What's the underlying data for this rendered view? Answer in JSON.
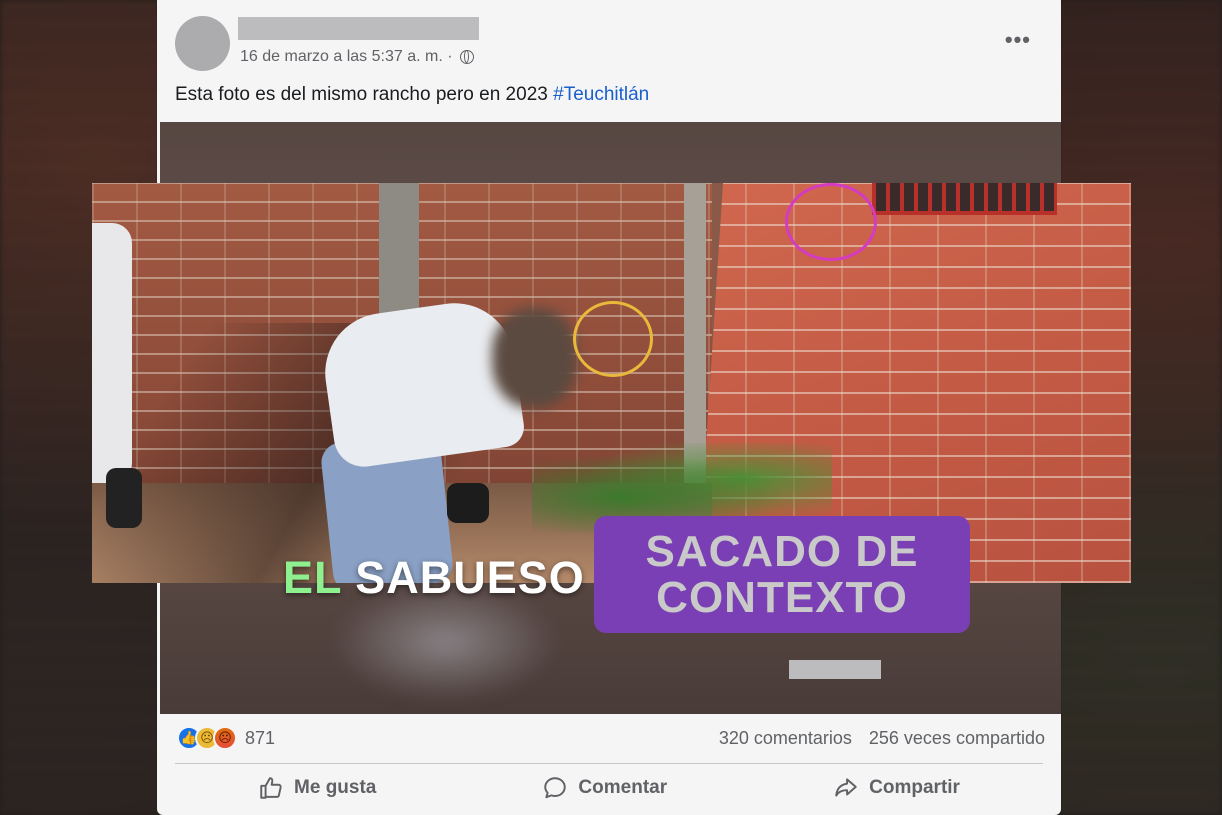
{
  "post": {
    "date": "16 de marzo a las 5:37 a. m. ·",
    "more_label": "•••",
    "text": "Esta foto es del mismo rancho pero en 2023",
    "hashtag": "#Teuchitlán",
    "reaction_count": "871",
    "comments": "320 comentarios",
    "shares": "256 veces compartido",
    "reactions": [
      "like-icon",
      "sad-icon",
      "angry-icon"
    ]
  },
  "actions": {
    "like": "Me gusta",
    "comment": "Comentar",
    "share": "Compartir"
  },
  "overlay": {
    "brand_el": "EL",
    "brand_name": "SABUESO",
    "badge_line1": "SACADO DE",
    "badge_line2": "CONTEXTO"
  },
  "colors": {
    "hashtag": "#1b63d6",
    "brand_accent": "#8ef08f",
    "badge_bg": "#7a3fb4",
    "circle_yellow": "#e8b93a",
    "circle_magenta": "#d43bc2"
  }
}
